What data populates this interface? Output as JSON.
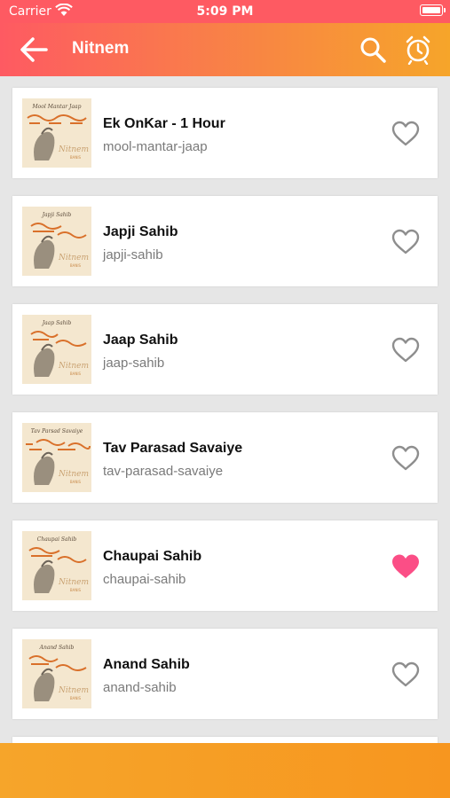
{
  "status_bar": {
    "carrier": "Carrier",
    "time": "5:09 PM"
  },
  "app_bar": {
    "title": "Nitnem",
    "icons": [
      "arrow-left-icon",
      "search-icon",
      "alarm-clock-icon"
    ]
  },
  "items": [
    {
      "title": "Ek OnKar - 1 Hour",
      "slug": "mool-mantar-jaap",
      "thumb_caption": "Mool Mantar Jaap",
      "favorite": false
    },
    {
      "title": "Japji Sahib",
      "slug": "japji-sahib",
      "thumb_caption": "Japji Sahib",
      "favorite": false
    },
    {
      "title": "Jaap Sahib",
      "slug": "jaap-sahib",
      "thumb_caption": "Jaap Sahib",
      "favorite": false
    },
    {
      "title": "Tav Parasad Savaiye",
      "slug": "tav-parasad-savaiye",
      "thumb_caption": "Tav Parsad Savaiye",
      "favorite": false
    },
    {
      "title": "Chaupai Sahib",
      "slug": "chaupai-sahib",
      "thumb_caption": "Chaupai Sahib",
      "favorite": true
    },
    {
      "title": "Anand Sahib",
      "slug": "anand-sahib",
      "thumb_caption": "Anand Sahib",
      "favorite": false
    }
  ],
  "colors": {
    "header_start": "#fe5a62",
    "header_end": "#f6a52a",
    "favorite_on": "#fb4e86",
    "favorite_off": "#8e8e8e"
  }
}
